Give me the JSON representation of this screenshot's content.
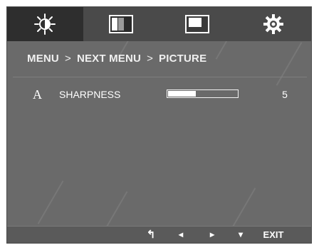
{
  "tabs": [
    {
      "name": "brightness",
      "icon": "sun-icon",
      "active": true
    },
    {
      "name": "contrast",
      "icon": "contrast-bars-icon",
      "active": false
    },
    {
      "name": "picture",
      "icon": "screen-window-icon",
      "active": false
    },
    {
      "name": "settings",
      "icon": "gear-icon",
      "active": false
    }
  ],
  "breadcrumb": {
    "level1": "MENU",
    "sep1": ">",
    "level2": "NEXT MENU",
    "sep2": ">",
    "level3": "PICTURE"
  },
  "setting": {
    "icon_text": "A",
    "label": "SHARPNESS",
    "value_text": "5",
    "level_fraction": 0.4
  },
  "footer": {
    "back_icon": "↰",
    "left_icon": "◂",
    "right_icon": "▸",
    "down_icon": "▾",
    "exit_label": "EXIT"
  },
  "colors": {
    "panel": "#6a6a6a",
    "tab_bar": "#4a4a4a",
    "active_tab": "#2e2e2e",
    "text": "#ffffff"
  }
}
